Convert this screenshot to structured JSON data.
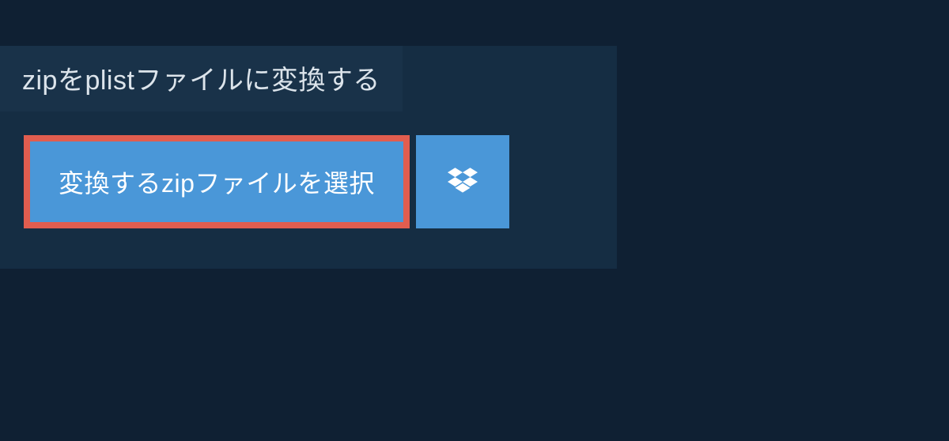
{
  "title": "zipをplistファイルに変換する",
  "buttons": {
    "select_file_label": "変換するzipファイルを選択"
  },
  "colors": {
    "page_background": "#0f2033",
    "container_background": "#152d43",
    "title_bar_background": "#193249",
    "button_background": "#4a97d8",
    "button_border": "#e15d4f",
    "text_light": "#dce4eb",
    "text_white": "#ffffff"
  }
}
